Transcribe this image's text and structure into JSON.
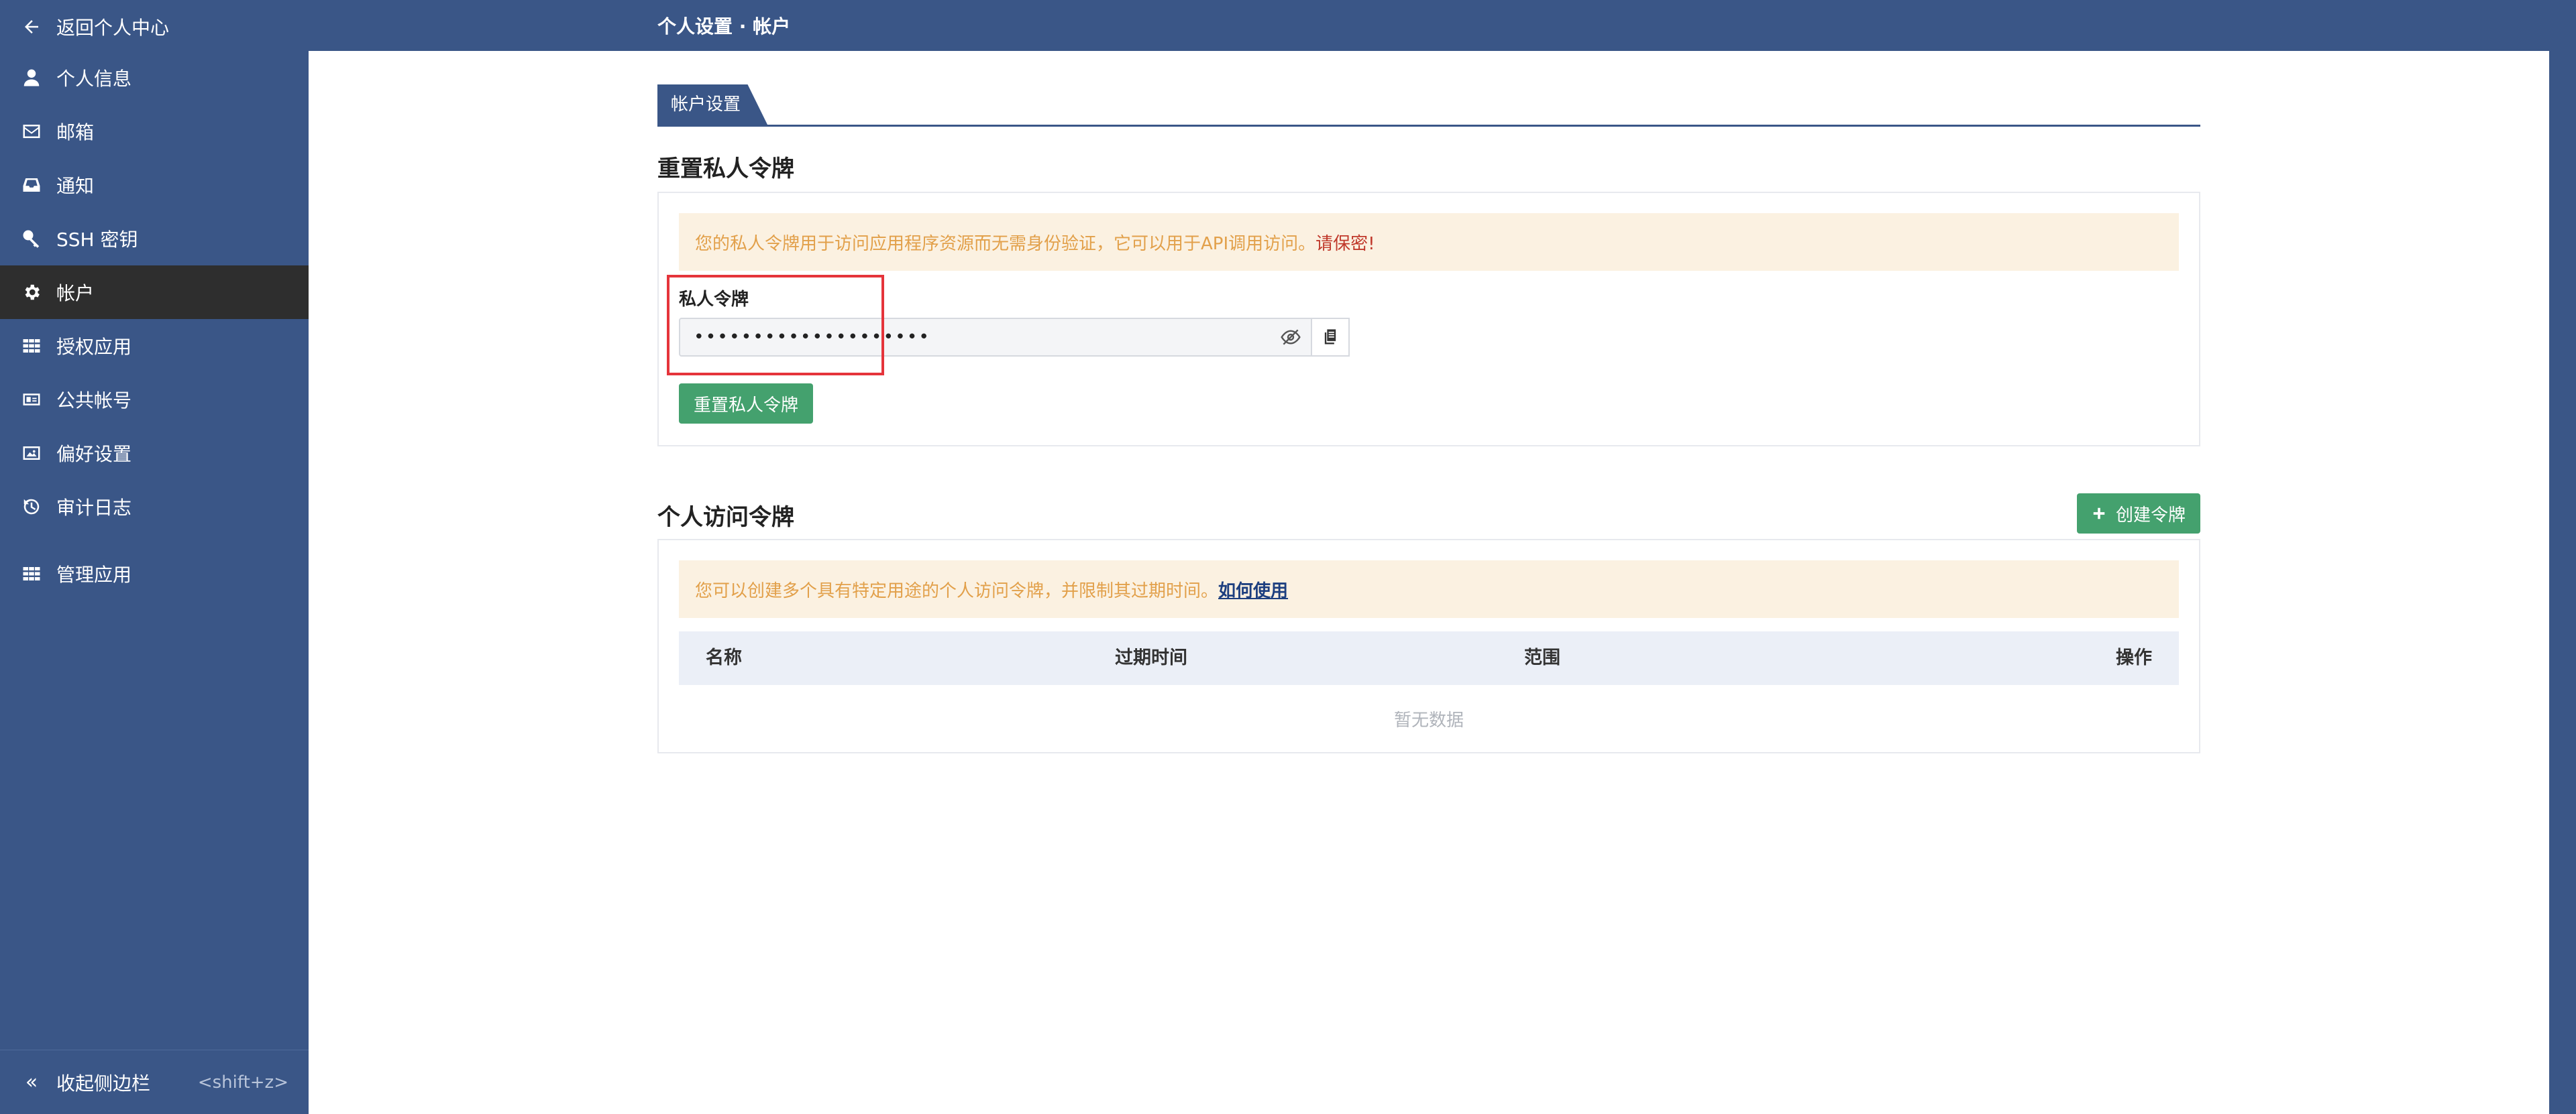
{
  "sidebar": {
    "back_label": "返回个人中心",
    "items": [
      {
        "label": "个人信息",
        "icon": "user-icon"
      },
      {
        "label": "邮箱",
        "icon": "mail-icon"
      },
      {
        "label": "通知",
        "icon": "inbox-icon"
      },
      {
        "label": "SSH 密钥",
        "icon": "key-icon"
      },
      {
        "label": "帐户",
        "icon": "gear-icon",
        "active": true
      },
      {
        "label": "授权应用",
        "icon": "grid-icon"
      },
      {
        "label": "公共帐号",
        "icon": "id-card-icon"
      },
      {
        "label": "偏好设置",
        "icon": "image-icon"
      },
      {
        "label": "审计日志",
        "icon": "history-icon"
      }
    ],
    "manage_label": "管理应用",
    "collapse_label": "收起侧边栏",
    "collapse_hint": "<shift+z>"
  },
  "header": {
    "title": "个人设置 · 帐户"
  },
  "main": {
    "tab_label": "帐户设置",
    "reset_section": {
      "title": "重置私人令牌",
      "alert_text": "您的私人令牌用于访问应用程序资源而无需身份验证，它可以用于API调用访问。",
      "alert_warning": "请保密!",
      "field_label": "私人令牌",
      "token_value": "••••••••••••••••••••",
      "reset_button": "重置私人令牌"
    },
    "access_section": {
      "title": "个人访问令牌",
      "create_button": "创建令牌",
      "alert_text": "您可以创建多个具有特定用途的个人访问令牌，并限制其过期时间。",
      "alert_link": "如何使用",
      "columns": [
        "名称",
        "过期时间",
        "范围",
        "操作"
      ],
      "empty_text": "暂无数据"
    }
  },
  "colors": {
    "sidebar_bg": "#3a5687",
    "active_bg": "#2e2e2e",
    "accent_green": "#44a16e",
    "alert_bg": "#fbf1e1",
    "alert_text": "#e2a04a",
    "highlight_red": "#e5343b"
  }
}
